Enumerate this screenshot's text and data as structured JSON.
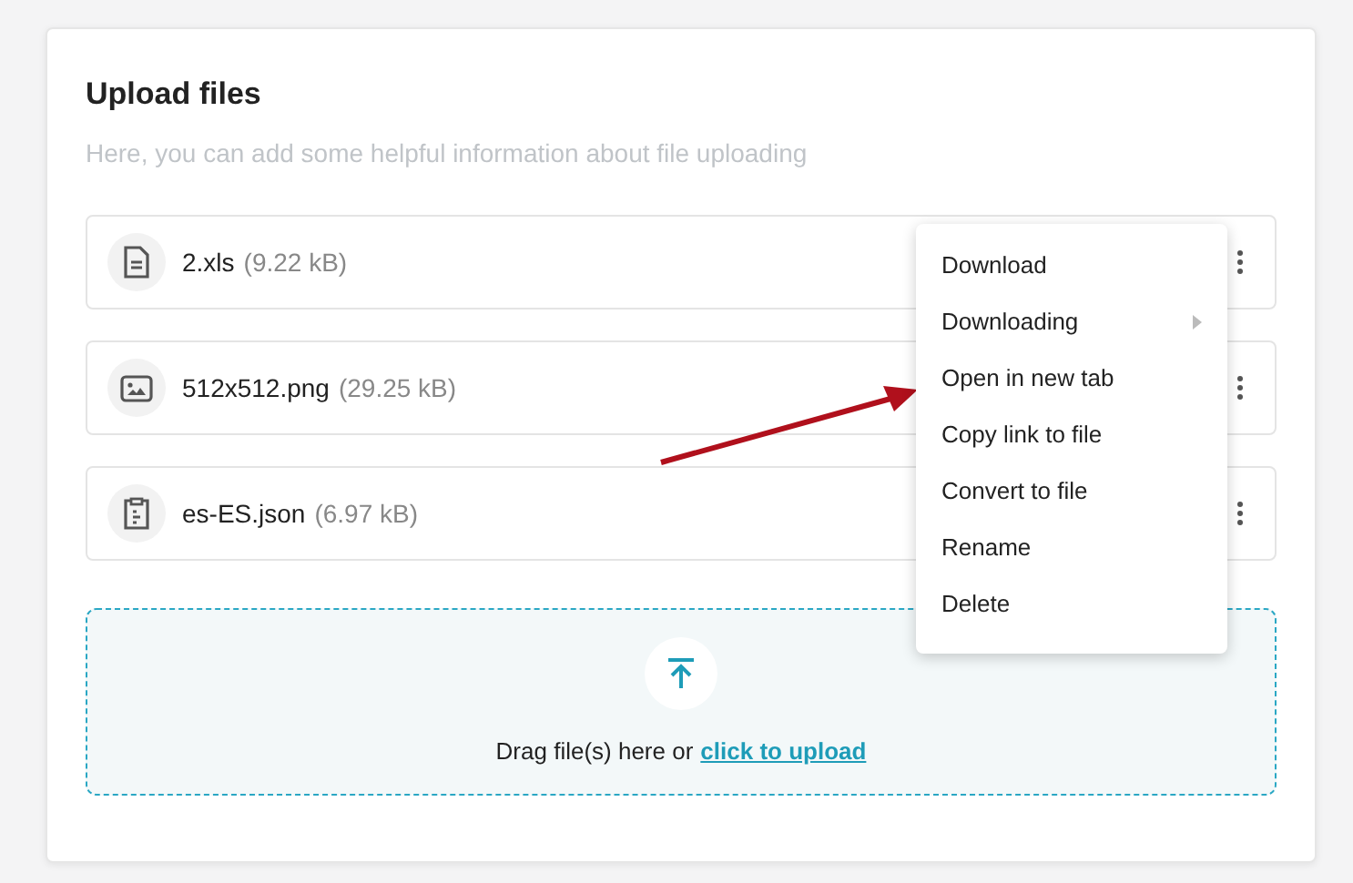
{
  "title": "Upload files",
  "subtitle": "Here, you can add some helpful information about file uploading",
  "files": [
    {
      "kind": "document",
      "name": "2.xls",
      "size": "(9.22 kB)"
    },
    {
      "kind": "image",
      "name": "512x512.png",
      "size": "(29.25 kB)"
    },
    {
      "kind": "clipboard",
      "name": "es-ES.json",
      "size": "(6.97 kB)"
    }
  ],
  "dropzone": {
    "text": "Drag file(s) here or",
    "link": "click to upload"
  },
  "context_menu": [
    {
      "label": "Download",
      "has_submenu": false
    },
    {
      "label": "Downloading",
      "has_submenu": true
    },
    {
      "label": "Open in new tab",
      "has_submenu": false
    },
    {
      "label": "Copy link to file",
      "has_submenu": false
    },
    {
      "label": "Convert to file",
      "has_submenu": false
    },
    {
      "label": "Rename",
      "has_submenu": false
    },
    {
      "label": "Delete",
      "has_submenu": false
    }
  ]
}
